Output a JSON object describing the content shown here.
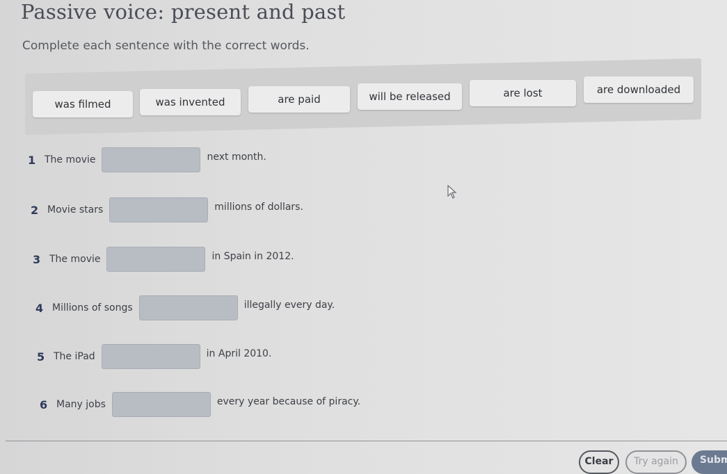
{
  "header": {
    "title": "Passive voice: present and past",
    "instruction": "Complete each sentence with the correct words."
  },
  "word_bank": [
    {
      "label": "was filmed"
    },
    {
      "label": "was invented"
    },
    {
      "label": "are paid"
    },
    {
      "label": "will be released"
    },
    {
      "label": "are lost"
    },
    {
      "label": "are downloaded"
    }
  ],
  "questions": [
    {
      "number": "1",
      "before": "The movie",
      "answer": "",
      "after": "next month."
    },
    {
      "number": "2",
      "before": "Movie stars",
      "answer": "",
      "after": "millions of dollars."
    },
    {
      "number": "3",
      "before": "The movie",
      "answer": "",
      "after": "in Spain in 2012."
    },
    {
      "number": "4",
      "before": "Millions of songs",
      "answer": "",
      "after": "illegally every day."
    },
    {
      "number": "5",
      "before": "The iPad",
      "answer": "",
      "after": "in April 2010."
    },
    {
      "number": "6",
      "before": "Many jobs",
      "answer": "",
      "after": "every year because of piracy."
    }
  ],
  "footer": {
    "clear_label": "Clear",
    "try_again_label": "Try again",
    "submit_label": "Submit"
  },
  "colors": {
    "number_accent": "#2e3a5a",
    "gap_fill": "#b8bcc3",
    "submit_bg": "#6b7a90"
  }
}
